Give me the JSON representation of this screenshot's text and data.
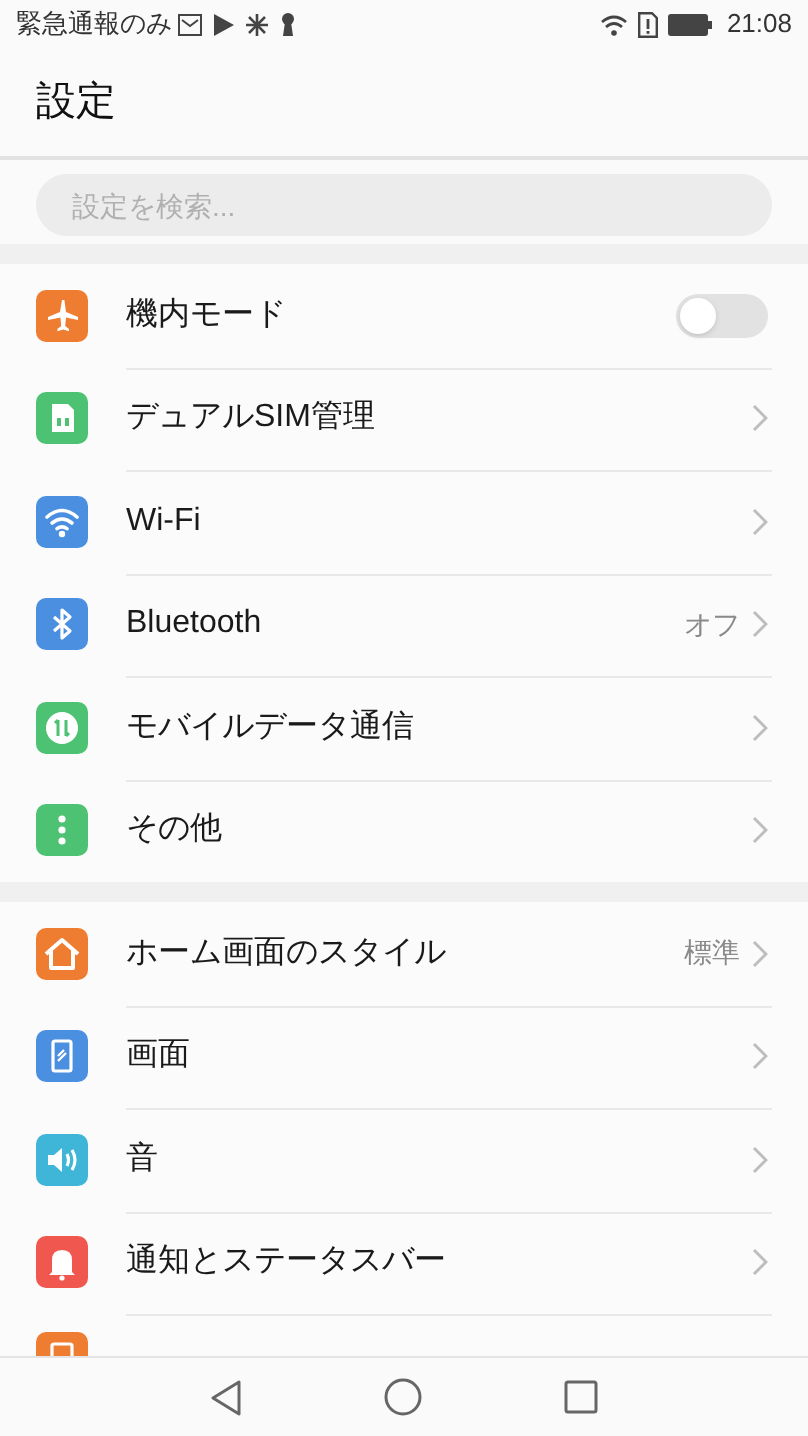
{
  "status_bar": {
    "carrier": "緊急通報のみ",
    "time": "21:08"
  },
  "header": {
    "title": "設定"
  },
  "search": {
    "placeholder": "設定を検索..."
  },
  "sections": [
    {
      "items": [
        {
          "kind": "toggle",
          "color": "#ef7d31",
          "label": "機内モード",
          "on": false
        },
        {
          "kind": "link",
          "color": "#4cc272",
          "label": "デュアルSIM管理"
        },
        {
          "kind": "link",
          "color": "#4a8fe0",
          "label": "Wi-Fi"
        },
        {
          "kind": "link",
          "color": "#4a8fe0",
          "label": "Bluetooth",
          "value": "オフ"
        },
        {
          "kind": "link",
          "color": "#4cc272",
          "label": "モバイルデータ通信"
        },
        {
          "kind": "link",
          "color": "#4cc272",
          "label": "その他"
        }
      ]
    },
    {
      "items": [
        {
          "kind": "link",
          "color": "#ef7d31",
          "label": "ホーム画面のスタイル",
          "value": "標準"
        },
        {
          "kind": "link",
          "color": "#4a8fe0",
          "label": "画面"
        },
        {
          "kind": "link",
          "color": "#3fb6d8",
          "label": "音"
        },
        {
          "kind": "link",
          "color": "#f0574e",
          "label": "通知とステータスバー"
        },
        {
          "kind": "partial",
          "color": "#ef7d31"
        }
      ]
    }
  ]
}
